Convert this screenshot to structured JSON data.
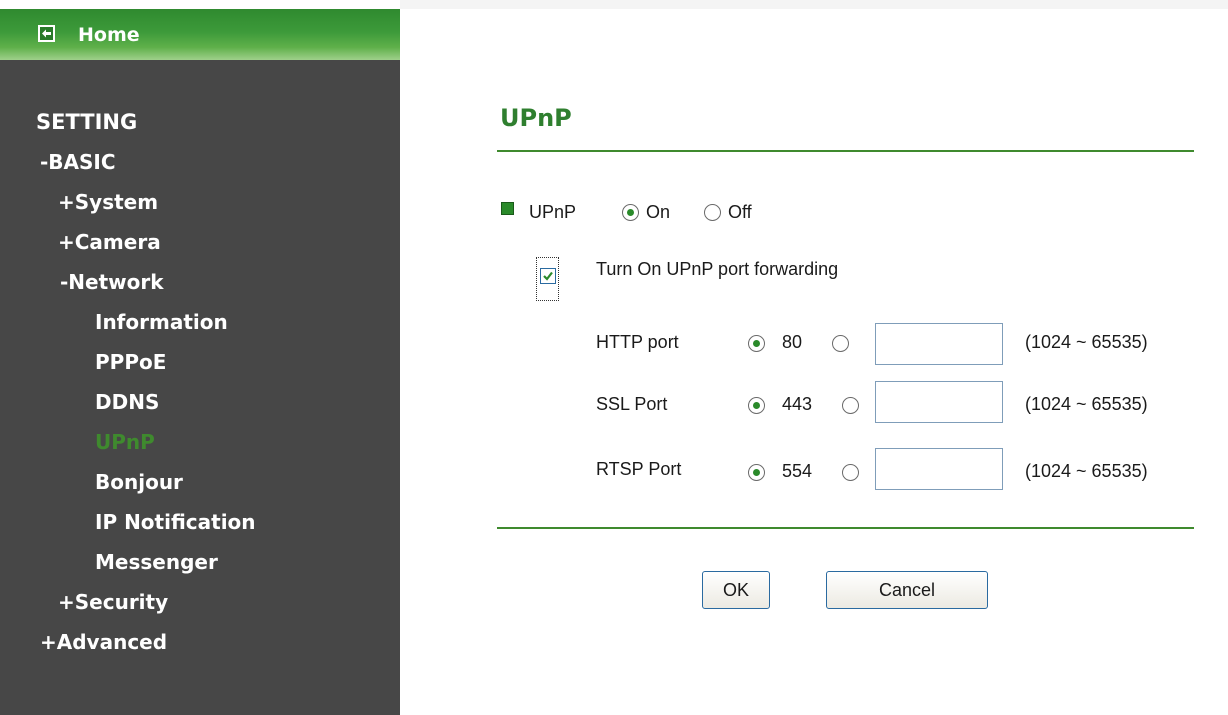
{
  "sidebar": {
    "home_label": "Home",
    "items": [
      {
        "label": "SETTING",
        "active": false
      },
      {
        "label": "-BASIC",
        "active": false
      },
      {
        "label": "+System",
        "active": false
      },
      {
        "label": "+Camera",
        "active": false
      },
      {
        "label": "-Network",
        "active": false
      },
      {
        "label": "Information",
        "active": false
      },
      {
        "label": "PPPoE",
        "active": false
      },
      {
        "label": "DDNS",
        "active": false
      },
      {
        "label": "UPnP",
        "active": true
      },
      {
        "label": "Bonjour",
        "active": false
      },
      {
        "label": "IP Notification",
        "active": false
      },
      {
        "label": "Messenger",
        "active": false
      },
      {
        "label": "+Security",
        "active": false
      },
      {
        "label": "+Advanced",
        "active": false
      }
    ]
  },
  "main": {
    "title": "UPnP",
    "upnp": {
      "label": "UPnP",
      "on_label": "On",
      "off_label": "Off",
      "selected": "On"
    },
    "port_forwarding": {
      "label": "Turn On UPnP port forwarding",
      "checked": true
    },
    "ports": [
      {
        "label": "HTTP port",
        "default": "80",
        "custom_value": "",
        "range": "(1024 ~ 65535)",
        "selected": "default"
      },
      {
        "label": "SSL Port",
        "default": "443",
        "custom_value": "",
        "range": "(1024 ~ 65535)",
        "selected": "default"
      },
      {
        "label": "RTSP Port",
        "default": "554",
        "custom_value": "",
        "range": "(1024 ~ 65535)",
        "selected": "default"
      }
    ],
    "ok_label": "OK",
    "cancel_label": "Cancel"
  },
  "colors": {
    "accent_green": "#3f8a2e",
    "sidebar_bg": "#474747"
  }
}
